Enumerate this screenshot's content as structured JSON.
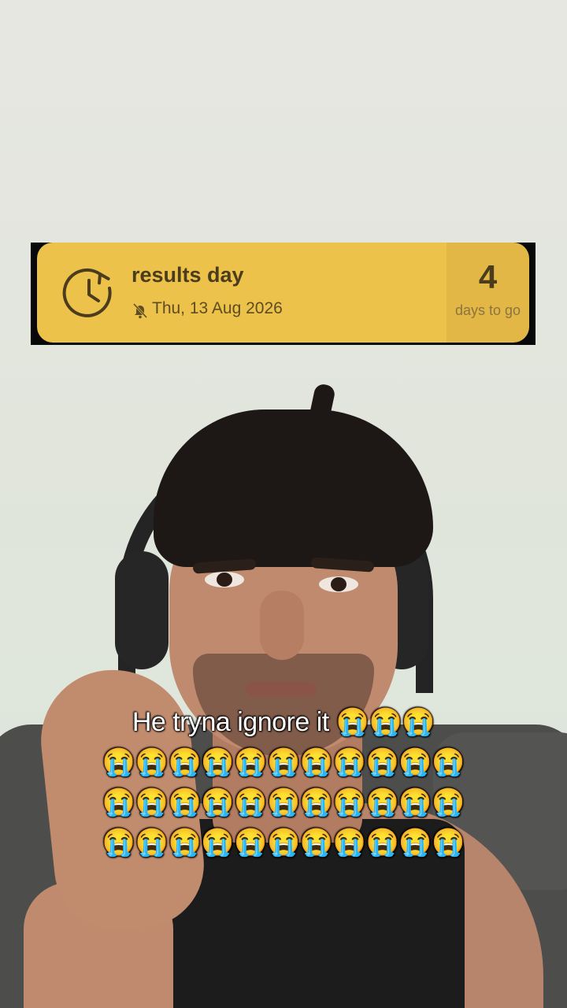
{
  "widget": {
    "title": "results day",
    "date": "Thu, 13 Aug 2026",
    "countdown_number": "4",
    "countdown_label": "days to go",
    "icons": [
      "clock-icon",
      "silent-icon"
    ],
    "colors": {
      "accent": "#ecc24a",
      "side": "#e2b745",
      "text_dark": "#4a3c1c"
    }
  },
  "caption": {
    "line1": "He tryna ignore it 😭😭😭",
    "line2": "😭😭😭😭😭😭😭😭😭😭😭",
    "line3": "😭😭😭😭😭😭😭😭😭😭😭",
    "line4": "😭😭😭😭😭😭😭😭😭😭😭"
  }
}
